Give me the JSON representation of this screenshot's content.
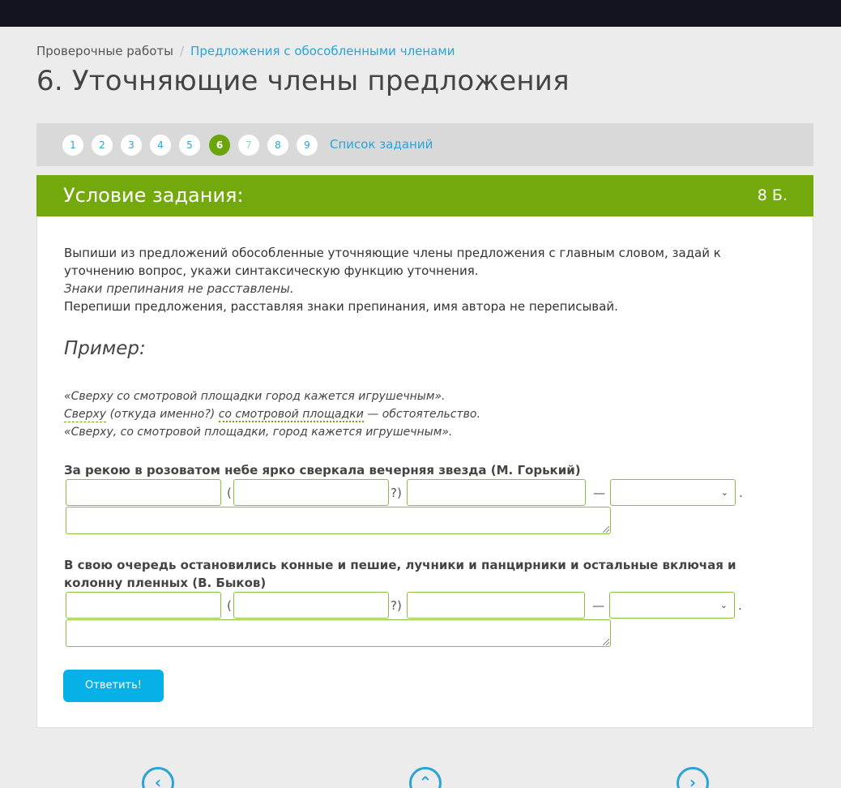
{
  "breadcrumb": {
    "root": "Проверочные работы",
    "separator": "/",
    "current": "Предложения с обособленными членами"
  },
  "page_title": "6. Уточняющие члены предложения",
  "pager": {
    "numbers": [
      "1",
      "2",
      "3",
      "4",
      "5",
      "6",
      "7",
      "8",
      "9"
    ],
    "active": "6",
    "list_label": "Список заданий"
  },
  "card": {
    "title": "Условие задания:",
    "points": "8 Б.",
    "instructions": {
      "p1": "Выпиши из предложений обособленные уточняющие члены предложения с главным словом, задай к уточнению вопрос, укажи синтаксическую функцию уточнения.",
      "p2": "Знаки препинания не расставлены.",
      "p3": "Перепиши предложения, расставляя знаки препинания, имя автора не переписывай."
    },
    "example_heading": "Пример:",
    "example": {
      "line1": "«Сверху со смотровой площадки город кажется игрушечным».",
      "word": "Сверху",
      "question": "(откуда именно?)",
      "phrase": "со смотровой площадки",
      "function": "— обстоятельство.",
      "line3": "«Сверху, со смотровой площадки, город кажется игрушечным»."
    },
    "questions": [
      {
        "text": "За рекою в розоватом небе ярко сверкала вечерняя звезда (М. Горький)"
      },
      {
        "text": "В свою очередь остановились конные и пешие, лучники и панцирники и остальные включая и колонну пленных (В. Быков)"
      }
    ],
    "symbols": {
      "open_paren": "(",
      "close_q": "?)",
      "dash": "—",
      "period": "."
    },
    "submit_label": "Ответить!"
  },
  "nav": {
    "prev_icon": "chevron-left-icon",
    "up_icon": "chevron-up-icon",
    "next_icon": "chevron-right-icon"
  },
  "colors": {
    "accent_green": "#73a90d",
    "link_blue": "#29a3d8",
    "button_blue": "#08b0e8"
  }
}
